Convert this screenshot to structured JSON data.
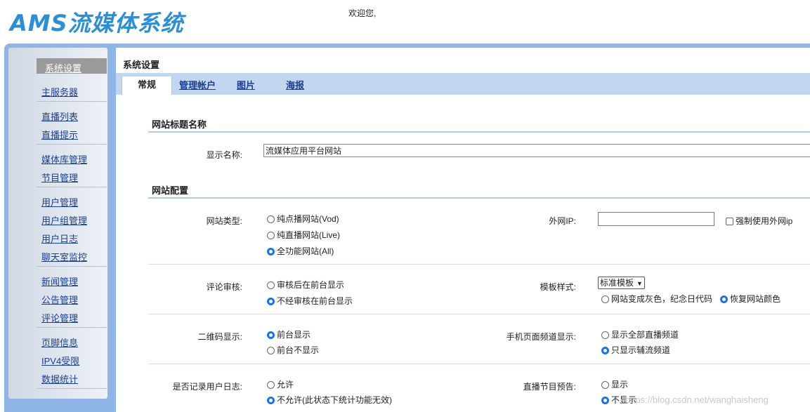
{
  "header": {
    "logo": "AMS流媒体系统",
    "welcome": "欢迎您,"
  },
  "sidebar": {
    "header": "系统设置",
    "items": [
      "主服务器",
      "直播列表",
      "直播提示",
      "媒体库管理",
      "节目管理",
      "用户管理",
      "用户组管理",
      "用户日志",
      "聊天室监控",
      "新闻管理",
      "公告管理",
      "评论管理",
      "页脚信息",
      "IPV4受限",
      "数据统计"
    ]
  },
  "main": {
    "title": "系统设置",
    "tabs": [
      "常规",
      "管理帐户",
      "图片",
      "海报"
    ],
    "active_tab": "常规"
  },
  "section1": {
    "title": "网站标题名称",
    "display_name_label": "显示名称:",
    "display_name_value": "流媒体应用平台网站"
  },
  "section2": {
    "title": "网站配置",
    "site_type": {
      "label": "网站类型:",
      "options": [
        "纯点播网站(Vod)",
        "纯直播网站(Live)",
        "全功能网站(All)"
      ],
      "selected": 2
    },
    "external_ip": {
      "label": "外网IP:",
      "value": "",
      "force_label": "强制使用外网ip",
      "force_checked": false
    },
    "comment_review": {
      "label": "评论审核:",
      "options": [
        "审核后在前台显示",
        "不经审核在前台显示"
      ],
      "selected": 1
    },
    "template_style": {
      "label": "模板样式:",
      "select_value": "标准模板",
      "options": [
        "网站变成灰色，纪念日代码",
        "恢复网站颜色"
      ],
      "selected": 1
    },
    "qrcode": {
      "label": "二维码显示:",
      "options": [
        "前台显示",
        "前台不显示"
      ],
      "selected": 0
    },
    "mobile_channel": {
      "label": "手机页面频道显示:",
      "options": [
        "显示全部直播频道",
        "只显示辅流频道"
      ],
      "selected": 1
    },
    "user_log": {
      "label": "是否记录用户日志:",
      "options": [
        "允许",
        "不允许(此状态下统计功能无效)"
      ],
      "selected": 1
    },
    "live_preview": {
      "label": "直播节目预告:",
      "options": [
        "显示",
        "不显示"
      ],
      "selected": 1
    }
  },
  "watermark": "https://blog.csdn.net/wanghaisheng"
}
